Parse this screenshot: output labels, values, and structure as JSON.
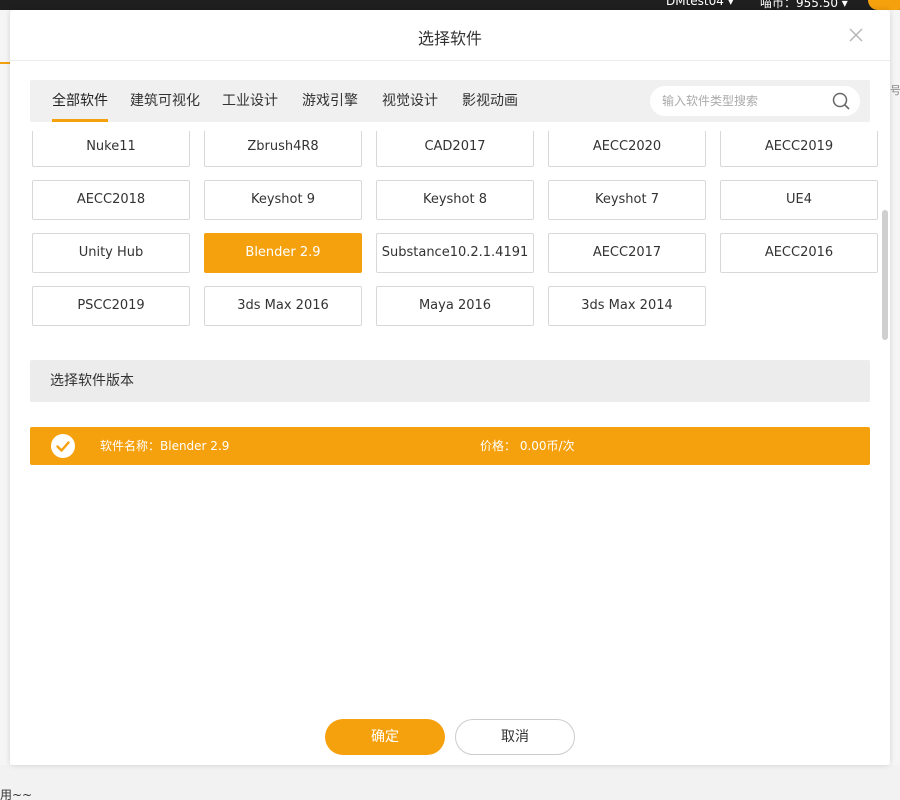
{
  "background": {
    "user": "DMtest04 ▾",
    "balance": "喵币：955.50 ▾",
    "right_fragment": "号",
    "bottom_text": "用~~"
  },
  "dialog": {
    "title": "选择软件"
  },
  "tabs": [
    {
      "label": "全部软件",
      "active": true
    },
    {
      "label": "建筑可视化",
      "active": false
    },
    {
      "label": "工业设计",
      "active": false
    },
    {
      "label": "游戏引擎",
      "active": false
    },
    {
      "label": "视觉设计",
      "active": false
    },
    {
      "label": "影视动画",
      "active": false
    }
  ],
  "search": {
    "placeholder": "输入软件类型搜索",
    "value": ""
  },
  "software": [
    {
      "label": "Nuke11",
      "selected": false
    },
    {
      "label": "Zbrush4R8",
      "selected": false
    },
    {
      "label": "CAD2017",
      "selected": false
    },
    {
      "label": "AECC2020",
      "selected": false
    },
    {
      "label": "AECC2019",
      "selected": false
    },
    {
      "label": "AECC2018",
      "selected": false
    },
    {
      "label": "Keyshot 9",
      "selected": false
    },
    {
      "label": "Keyshot 8",
      "selected": false
    },
    {
      "label": "Keyshot 7",
      "selected": false
    },
    {
      "label": "UE4",
      "selected": false
    },
    {
      "label": "Unity Hub",
      "selected": false
    },
    {
      "label": "Blender 2.9",
      "selected": true
    },
    {
      "label": "Substance10.2.1.4191",
      "selected": false
    },
    {
      "label": "AECC2017",
      "selected": false
    },
    {
      "label": "AECC2016",
      "selected": false
    },
    {
      "label": "PSCC2019",
      "selected": false
    },
    {
      "label": "3ds Max 2016",
      "selected": false
    },
    {
      "label": "Maya 2016",
      "selected": false
    },
    {
      "label": "3ds Max 2014",
      "selected": false
    }
  ],
  "version_section": {
    "title": "选择软件版本",
    "selected_row": {
      "name": "软件名称：Blender 2.9",
      "price": "价格：   0.00币/次"
    }
  },
  "footer": {
    "confirm_label": "确定",
    "cancel_label": "取消"
  },
  "colors": {
    "accent": "#f5a10d",
    "border": "#d8d8d8",
    "tab_bar": "#f0f0f0"
  },
  "icons": {
    "close": "close-icon",
    "search": "search-icon",
    "check": "check-circle-icon"
  }
}
